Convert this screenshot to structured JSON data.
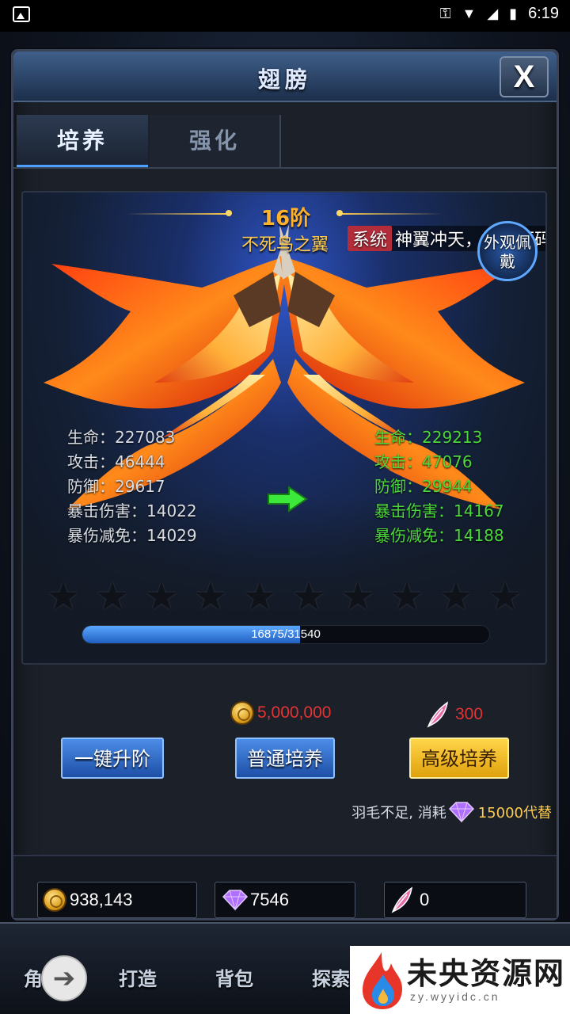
{
  "statusbar": {
    "time": "6:19",
    "icons": [
      "image-icon",
      "key-icon",
      "wifi-icon",
      "signal-icon",
      "battery-icon"
    ]
  },
  "window": {
    "title": "翅膀",
    "close_label": "X"
  },
  "tabs": [
    {
      "label": "培养",
      "active": true
    },
    {
      "label": "强化",
      "active": false
    }
  ],
  "wing": {
    "rank": "16阶",
    "name": "不死鸟之翼",
    "system_tag": "系统",
    "system_message": "神翼冲天，手游源码",
    "outfit_button": "外观佩戴"
  },
  "stats_current": [
    {
      "label": "生命：227083"
    },
    {
      "label": "攻击：46444"
    },
    {
      "label": "防御：29617"
    },
    {
      "label": "暴击伤害：14022"
    },
    {
      "label": "暴伤减免：14029"
    }
  ],
  "stats_next": [
    {
      "label": "生命：229213"
    },
    {
      "label": "攻击：47076"
    },
    {
      "label": "防御：29944"
    },
    {
      "label": "暴击伤害：14167"
    },
    {
      "label": "暴伤减免：14188"
    }
  ],
  "stars": {
    "total": 10,
    "filled": 0
  },
  "progress": {
    "text": "16875/31540",
    "current": 16875,
    "max": 31540
  },
  "costs": {
    "normal": "5,000,000",
    "advanced": "300"
  },
  "buttons": {
    "one_key": "一键升阶",
    "normal": "普通培养",
    "advanced": "高级培养"
  },
  "note": {
    "text": "羽毛不足, 消耗",
    "amount": "15000代替"
  },
  "resources": {
    "gold": "938,143",
    "gems": "7546",
    "feathers": "0"
  },
  "nav": {
    "items": [
      "角",
      "打造",
      "背包",
      "探索"
    ]
  },
  "watermark": {
    "title": "未央资源网",
    "url": "zy.wyyidc.cn"
  },
  "colors": {
    "accent_blue": "#4ea0ff",
    "stat_green": "#4cd83a",
    "rank_gold": "#ffb12b",
    "cost_red": "#e23434"
  }
}
